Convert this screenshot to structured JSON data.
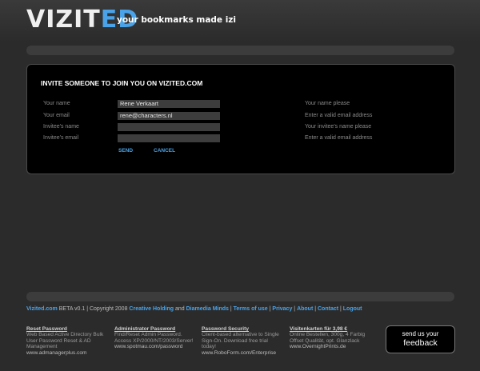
{
  "header": {
    "logo_part1": "VIZIT",
    "logo_part2": "ED",
    "tagline": "your bookmarks made izi"
  },
  "invite": {
    "title": "INVITE SOMEONE TO JOIN YOU ON VIZITED.COM",
    "rows": [
      {
        "label": "Your name",
        "value": "Rene Verkaart",
        "hint": "Your name please"
      },
      {
        "label": "Your email",
        "value": "rene@characters.nl",
        "hint": "Enter a valid email address"
      },
      {
        "label": "Invitee's name",
        "value": "",
        "hint": "Your invitee's name please"
      },
      {
        "label": "Invitee's email",
        "value": "",
        "hint": "Enter a valid email address"
      }
    ],
    "send_label": "SEND",
    "cancel_label": "CANCEL"
  },
  "footer": {
    "site": "Vizited.com",
    "beta": " BETA v0.1 | Copyright 2008 ",
    "creative": "Creative Holding",
    "and": " and ",
    "diamedia": "Diamedia Minds",
    "sep1": " | ",
    "terms": "Terms of use",
    "sep2": " | ",
    "privacy": "Privacy",
    "sep3": " | ",
    "about": "About",
    "sep4": " | ",
    "contact": "Contact",
    "sep5": " | ",
    "logout": "Logout"
  },
  "ads": [
    {
      "title": "Reset Password",
      "lines": [
        "Web Based Active Directory Bulk",
        "User Password Reset & AD",
        "Management"
      ],
      "url": "www.admanagerplus.com"
    },
    {
      "title": "Administrator Password",
      "lines": [
        "Find/Reset Admin Password.",
        "Access XP/2000/NT/2003/Server!"
      ],
      "url": "www.spotmau.com/password"
    },
    {
      "title": "Password Security",
      "lines": [
        "Client-based alternative to Single",
        "Sign-On. Download free trial",
        "today!"
      ],
      "url": "www.RoboForm.com/Enterprise"
    },
    {
      "title": "Visitenkarten für 3,98 €",
      "lines": [
        "Online Bestellen, 300g, 4 Farbig",
        "Offset Qualität, opt. Glanzlack"
      ],
      "url": "www.OvernightPrints.de"
    }
  ],
  "feedback": {
    "line1": "send us your",
    "line2": "feedback"
  }
}
